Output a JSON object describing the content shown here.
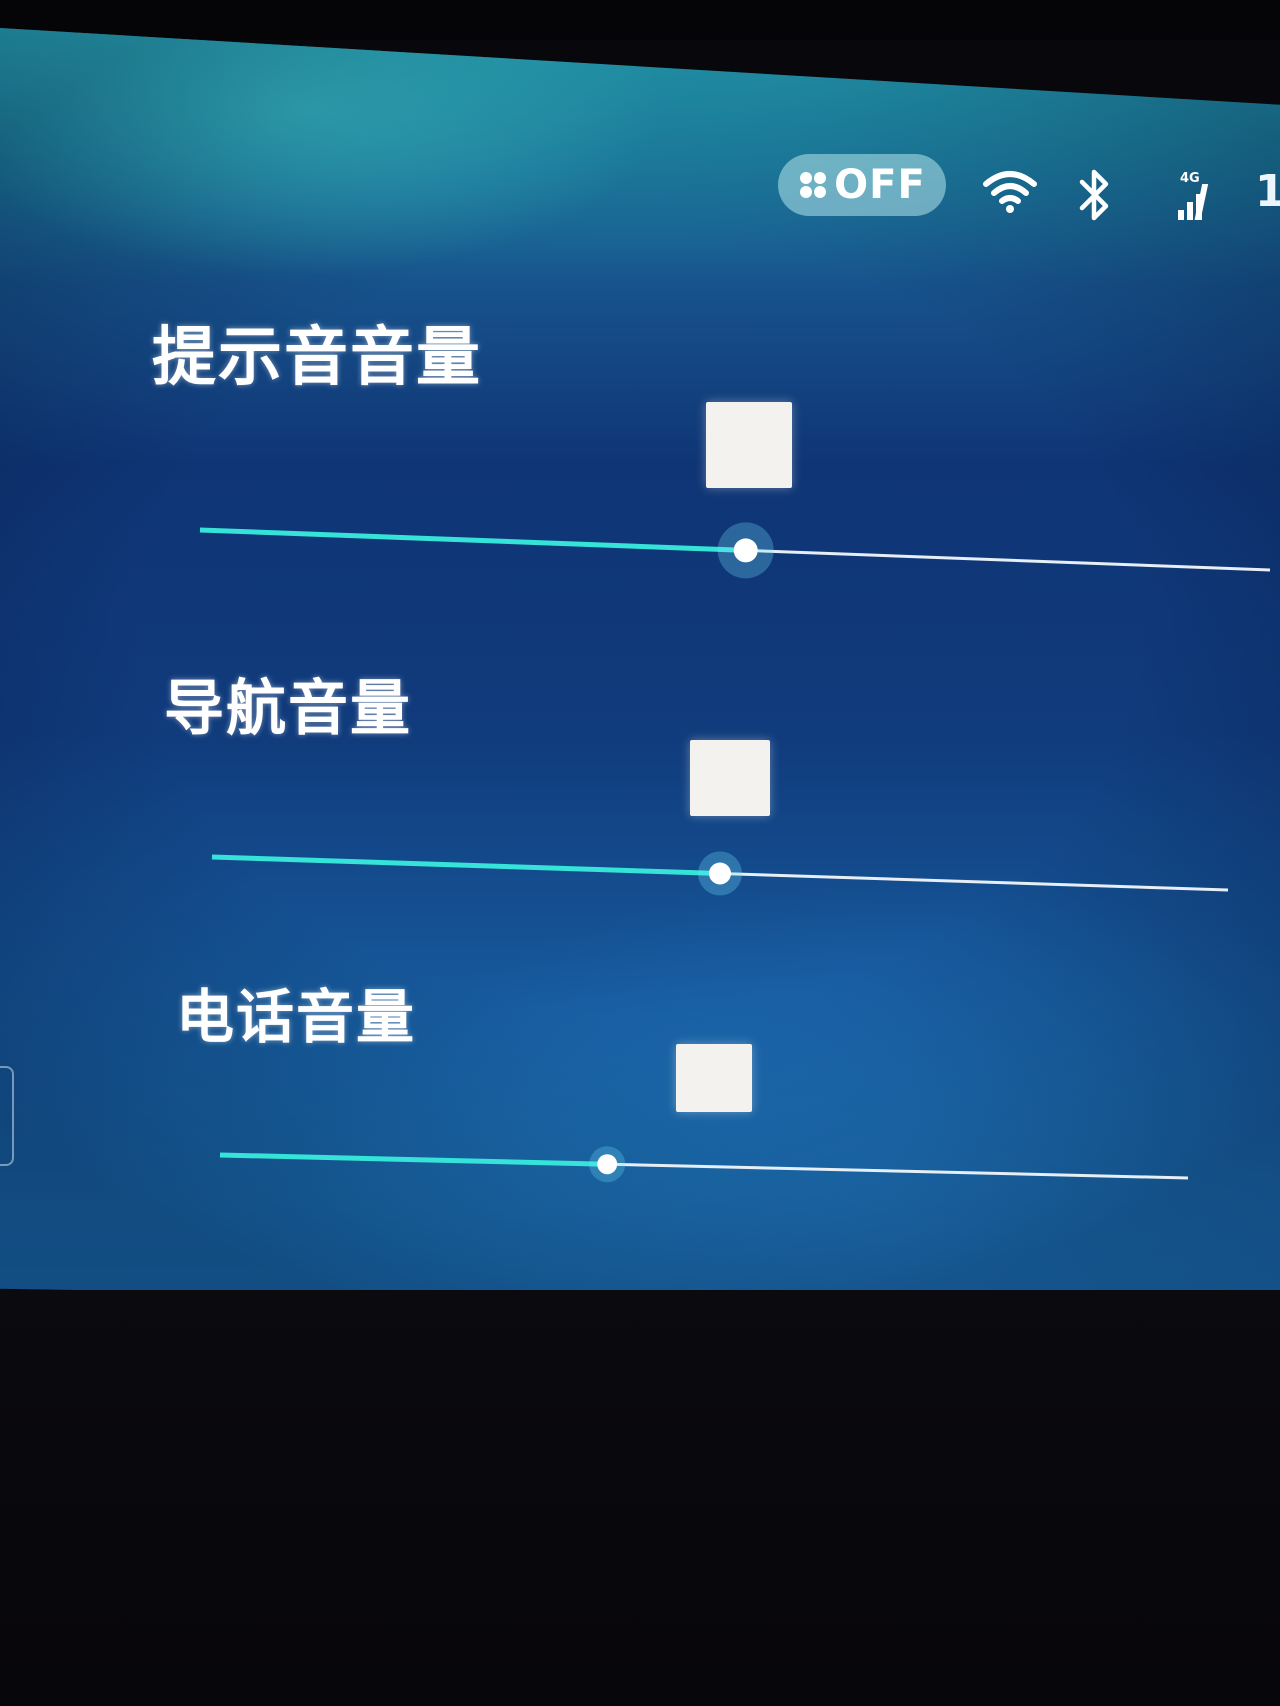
{
  "status_bar": {
    "pill_text": "OFF",
    "pill_icon": "grid-icon",
    "wifi_icon": "wifi-icon",
    "bluetooth_icon": "bluetooth-icon",
    "cell_icon": "signal-4g-icon",
    "cell_badge": "4G",
    "time_partial": "1"
  },
  "volume_settings": [
    {
      "label": "提示音音量",
      "slider_icon": "slider-knob",
      "level": 0.51
    },
    {
      "label": "导航音量",
      "slider_icon": "slider-knob",
      "level": 0.5
    },
    {
      "label": "电话音量",
      "slider_icon": "slider-knob",
      "level": 0.4
    }
  ],
  "colors": {
    "accent": "#35e3d8",
    "track_inactive": "#e6eef6",
    "knob": "#ffffff"
  }
}
